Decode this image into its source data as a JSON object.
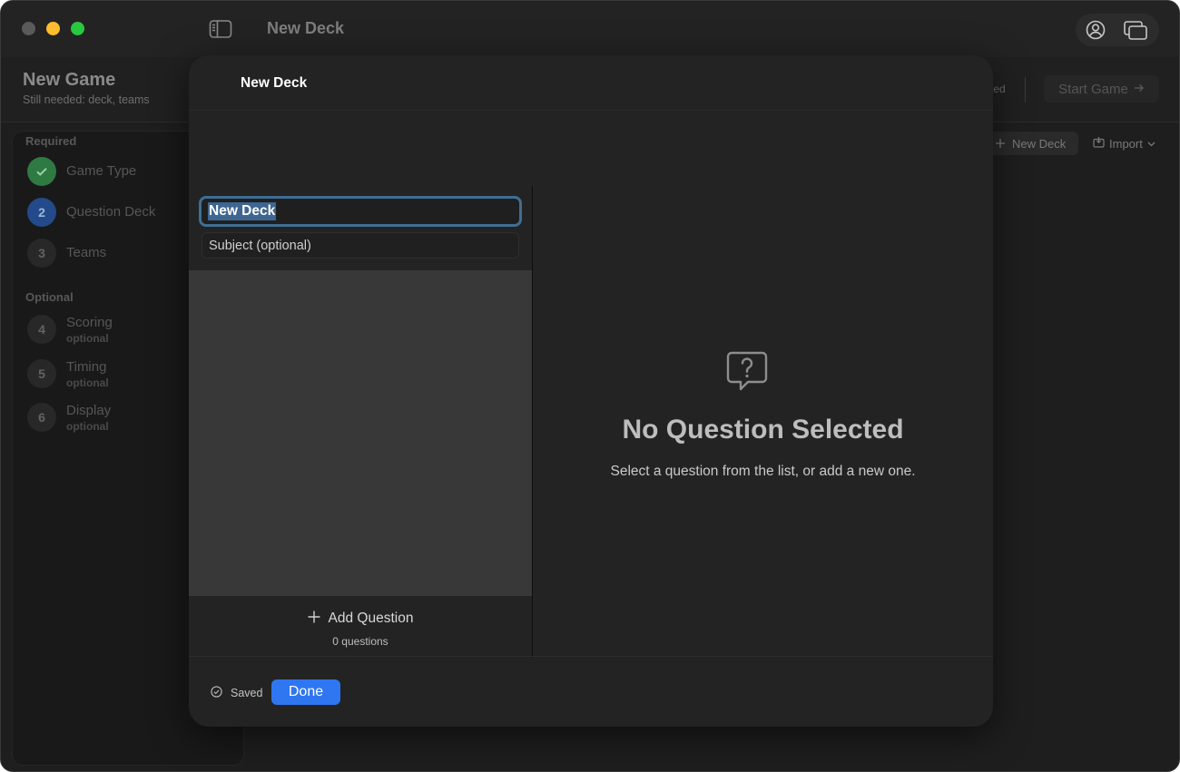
{
  "window": {
    "title": "New Deck"
  },
  "game": {
    "title": "New Game",
    "subtitle": "Still needed: deck, teams",
    "status_partial": "ted",
    "start_button": "Start Game"
  },
  "steps": {
    "required_label": "Required",
    "optional_label": "Optional",
    "required": [
      {
        "number": "",
        "label": "Game Type",
        "state": "done"
      },
      {
        "number": "2",
        "label": "Question Deck",
        "state": "active"
      },
      {
        "number": "3",
        "label": "Teams",
        "state": "pending"
      }
    ],
    "optional": [
      {
        "number": "4",
        "label": "Scoring",
        "sub": "optional"
      },
      {
        "number": "5",
        "label": "Timing",
        "sub": "optional"
      },
      {
        "number": "6",
        "label": "Display",
        "sub": "optional"
      }
    ]
  },
  "deck_actions": {
    "new_deck": "New Deck",
    "import": "Import"
  },
  "sheet": {
    "title": "New Deck",
    "deck_name_value": "New Deck",
    "subject_placeholder": "Subject (optional)",
    "add_question": "Add Question",
    "question_count": "0 questions",
    "empty_title": "No Question Selected",
    "empty_subtitle": "Select a question from the list, or add a new one.",
    "saved_label": "Saved",
    "done_button": "Done"
  },
  "colors": {
    "accent": "#2f76f1",
    "focus_ring": "#3f6e94",
    "success": "#2f7a43",
    "active_step": "#234a8a"
  }
}
